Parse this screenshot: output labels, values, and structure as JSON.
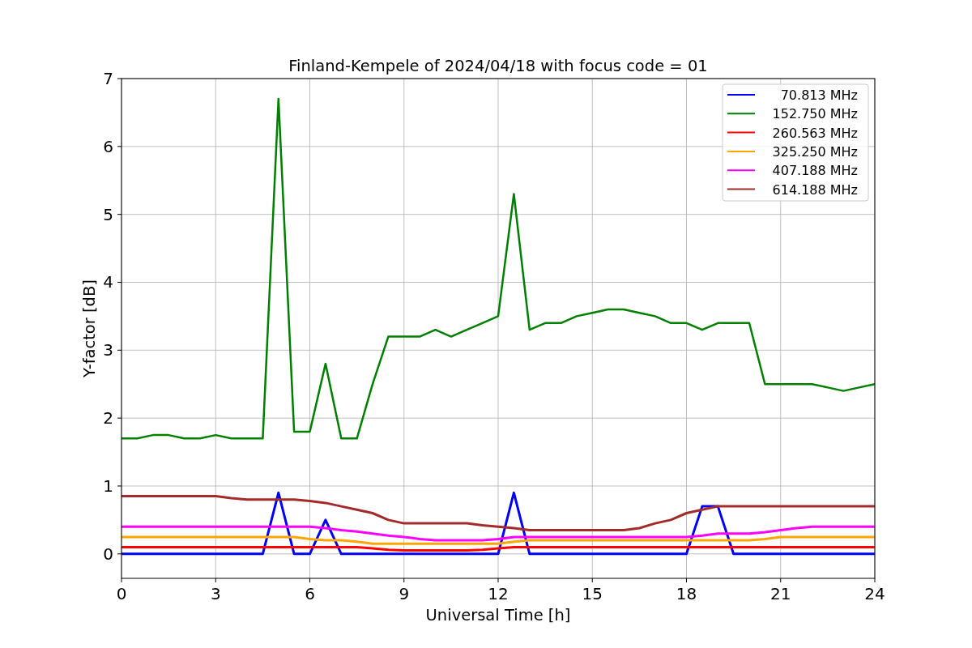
{
  "chart": {
    "chart_data": {
      "type": "line",
      "title": "Finland-Kempele of 2024/04/18 with focus code = 01",
      "xlabel": "Universal Time [h]",
      "ylabel": "Y-factor [dB]",
      "x": [
        0,
        0.5,
        1,
        1.5,
        2,
        2.5,
        3,
        3.5,
        4,
        4.5,
        5,
        5.5,
        6,
        6.5,
        7,
        7.5,
        8,
        8.5,
        9,
        9.5,
        10,
        10.5,
        11,
        11.5,
        12,
        12.5,
        13,
        13.5,
        14,
        14.5,
        15,
        15.5,
        16,
        16.5,
        17,
        17.5,
        18,
        18.5,
        19,
        19.5,
        20,
        20.5,
        21,
        21.5,
        22,
        22.5,
        23,
        23.5,
        24
      ],
      "series": [
        {
          "name": "70.813 MHz",
          "color": "#0000ff",
          "values": [
            0,
            0,
            0,
            0,
            0,
            0,
            0,
            0,
            0,
            0,
            0.9,
            0,
            0,
            0.5,
            0,
            0,
            0,
            0,
            0,
            0,
            0,
            0,
            0,
            0,
            0,
            0.9,
            0,
            0,
            0,
            0,
            0,
            0,
            0,
            0,
            0,
            0,
            0,
            0.7,
            0.7,
            0,
            0,
            0,
            0,
            0,
            0,
            0,
            0,
            0,
            0
          ]
        },
        {
          "name": "152.750 MHz",
          "color": "#008000",
          "values": [
            1.7,
            1.7,
            1.75,
            1.75,
            1.7,
            1.7,
            1.75,
            1.7,
            1.7,
            1.7,
            6.7,
            1.8,
            1.8,
            2.8,
            1.7,
            1.7,
            2.5,
            3.2,
            3.2,
            3.2,
            3.3,
            3.2,
            3.3,
            3.4,
            3.5,
            5.3,
            3.3,
            3.4,
            3.4,
            3.5,
            3.55,
            3.6,
            3.6,
            3.55,
            3.5,
            3.4,
            3.4,
            3.3,
            3.4,
            3.4,
            3.4,
            2.5,
            2.5,
            2.5,
            2.5,
            2.45,
            2.4,
            2.45,
            2.5
          ]
        },
        {
          "name": "260.563 MHz",
          "color": "#ff0000",
          "values": [
            0.1,
            0.1,
            0.1,
            0.1,
            0.1,
            0.1,
            0.1,
            0.1,
            0.1,
            0.1,
            0.1,
            0.1,
            0.1,
            0.1,
            0.1,
            0.1,
            0.08,
            0.06,
            0.05,
            0.05,
            0.05,
            0.05,
            0.05,
            0.06,
            0.08,
            0.1,
            0.1,
            0.1,
            0.1,
            0.1,
            0.1,
            0.1,
            0.1,
            0.1,
            0.1,
            0.1,
            0.1,
            0.1,
            0.1,
            0.1,
            0.1,
            0.1,
            0.1,
            0.1,
            0.1,
            0.1,
            0.1,
            0.1,
            0.1
          ]
        },
        {
          "name": "325.250 MHz",
          "color": "#ffa500",
          "values": [
            0.25,
            0.25,
            0.25,
            0.25,
            0.25,
            0.25,
            0.25,
            0.25,
            0.25,
            0.25,
            0.25,
            0.25,
            0.22,
            0.2,
            0.2,
            0.18,
            0.15,
            0.15,
            0.15,
            0.15,
            0.15,
            0.15,
            0.15,
            0.15,
            0.15,
            0.18,
            0.2,
            0.2,
            0.2,
            0.2,
            0.2,
            0.2,
            0.2,
            0.2,
            0.2,
            0.2,
            0.2,
            0.2,
            0.2,
            0.2,
            0.2,
            0.22,
            0.25,
            0.25,
            0.25,
            0.25,
            0.25,
            0.25,
            0.25
          ]
        },
        {
          "name": "407.188 MHz",
          "color": "#ff00ff",
          "values": [
            0.4,
            0.4,
            0.4,
            0.4,
            0.4,
            0.4,
            0.4,
            0.4,
            0.4,
            0.4,
            0.4,
            0.4,
            0.4,
            0.38,
            0.35,
            0.33,
            0.3,
            0.27,
            0.25,
            0.22,
            0.2,
            0.2,
            0.2,
            0.2,
            0.22,
            0.25,
            0.25,
            0.25,
            0.25,
            0.25,
            0.25,
            0.25,
            0.25,
            0.25,
            0.25,
            0.25,
            0.25,
            0.27,
            0.3,
            0.3,
            0.3,
            0.32,
            0.35,
            0.38,
            0.4,
            0.4,
            0.4,
            0.4,
            0.4
          ]
        },
        {
          "name": "614.188 MHz",
          "color": "#a52a2a",
          "values": [
            0.85,
            0.85,
            0.85,
            0.85,
            0.85,
            0.85,
            0.85,
            0.82,
            0.8,
            0.8,
            0.8,
            0.8,
            0.78,
            0.75,
            0.7,
            0.65,
            0.6,
            0.5,
            0.45,
            0.45,
            0.45,
            0.45,
            0.45,
            0.42,
            0.4,
            0.38,
            0.35,
            0.35,
            0.35,
            0.35,
            0.35,
            0.35,
            0.35,
            0.38,
            0.45,
            0.5,
            0.6,
            0.65,
            0.7,
            0.7,
            0.7,
            0.7,
            0.7,
            0.7,
            0.7,
            0.7,
            0.7,
            0.7,
            0.7
          ]
        }
      ],
      "grid": true,
      "legend": true,
      "xlim": [
        0,
        24
      ],
      "ylim": [
        -0.36,
        7
      ],
      "xticks": [
        0,
        3,
        6,
        9,
        12,
        15,
        18,
        21,
        24
      ],
      "yticks": [
        0,
        1,
        2,
        3,
        4,
        5,
        6,
        7
      ]
    }
  }
}
